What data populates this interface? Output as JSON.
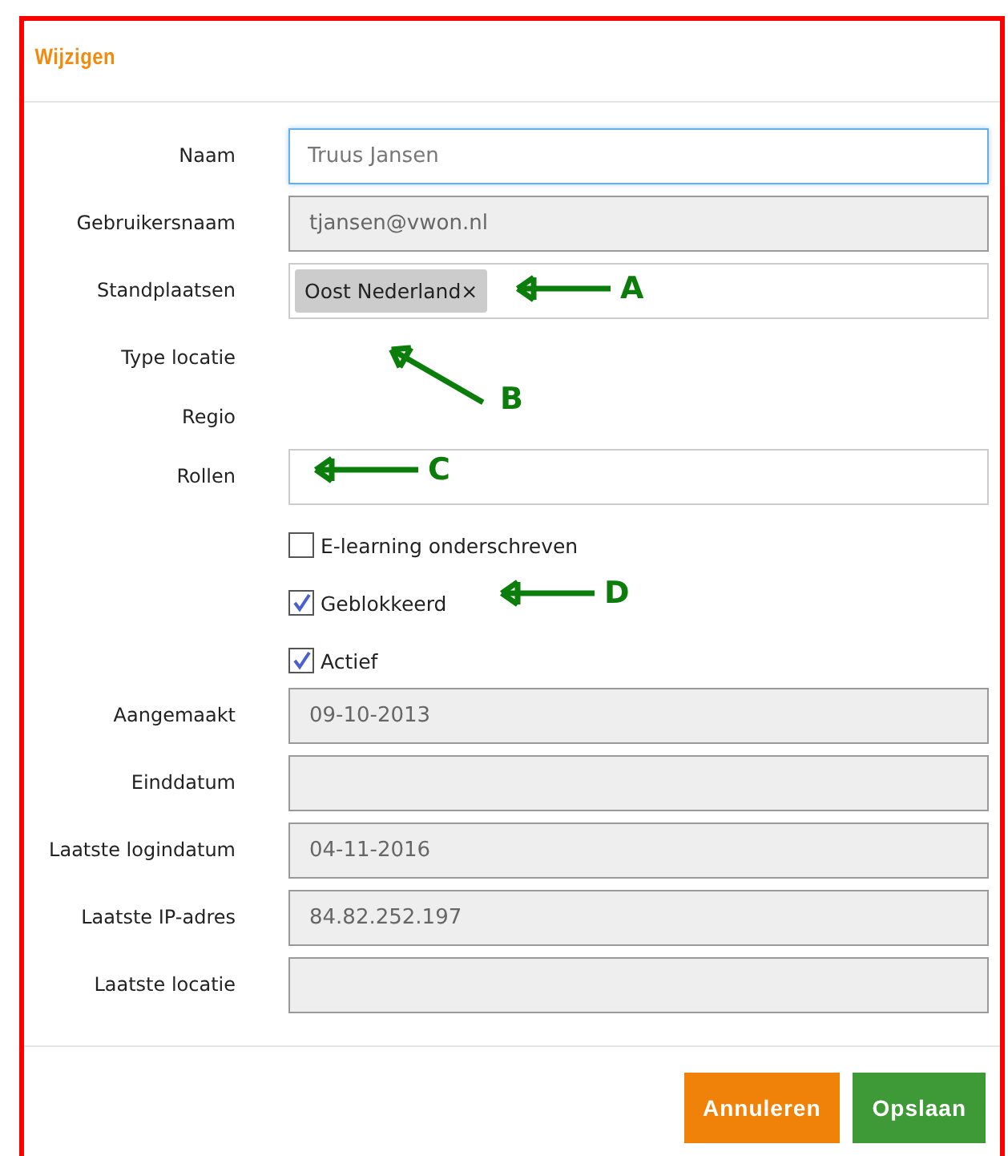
{
  "dialog": {
    "title": "Wijzigen"
  },
  "fields": [
    {
      "label": "Naam",
      "kind": "text",
      "value": "Truus Jansen",
      "focused": true
    },
    {
      "label": "Gebruikersnaam",
      "kind": "readonly",
      "value": "tjansen@vwon.nl"
    },
    {
      "label": "Standplaatsen",
      "kind": "tags",
      "tags": [
        {
          "label": "Oost Nederland",
          "remove": "×"
        }
      ]
    },
    {
      "label": "Type locatie",
      "kind": "none"
    },
    {
      "label": "Regio",
      "kind": "none"
    },
    {
      "label": "Rollen",
      "kind": "tags"
    }
  ],
  "checkboxes": [
    {
      "label": "E-learning onderschreven",
      "checked": false
    },
    {
      "label": "Geblokkeerd",
      "checked": true
    },
    {
      "label": "Actief",
      "checked": true
    }
  ],
  "info_fields": [
    {
      "label": "Aangemaakt",
      "value": "09-10-2013"
    },
    {
      "label": "Einddatum"
    },
    {
      "label": "Laatste logindatum",
      "value": "04-11-2016"
    },
    {
      "label": "Laatste IP-adres",
      "value": "84.82.252.197"
    },
    {
      "label": "Laatste locatie"
    }
  ],
  "buttons": [
    {
      "label": "Annuleren",
      "kind": "cancel"
    },
    {
      "label": "Opslaan",
      "kind": "save"
    }
  ],
  "annotations": [
    {
      "letter": "A"
    },
    {
      "letter": "B"
    },
    {
      "letter": "C"
    },
    {
      "letter": "D"
    }
  ]
}
